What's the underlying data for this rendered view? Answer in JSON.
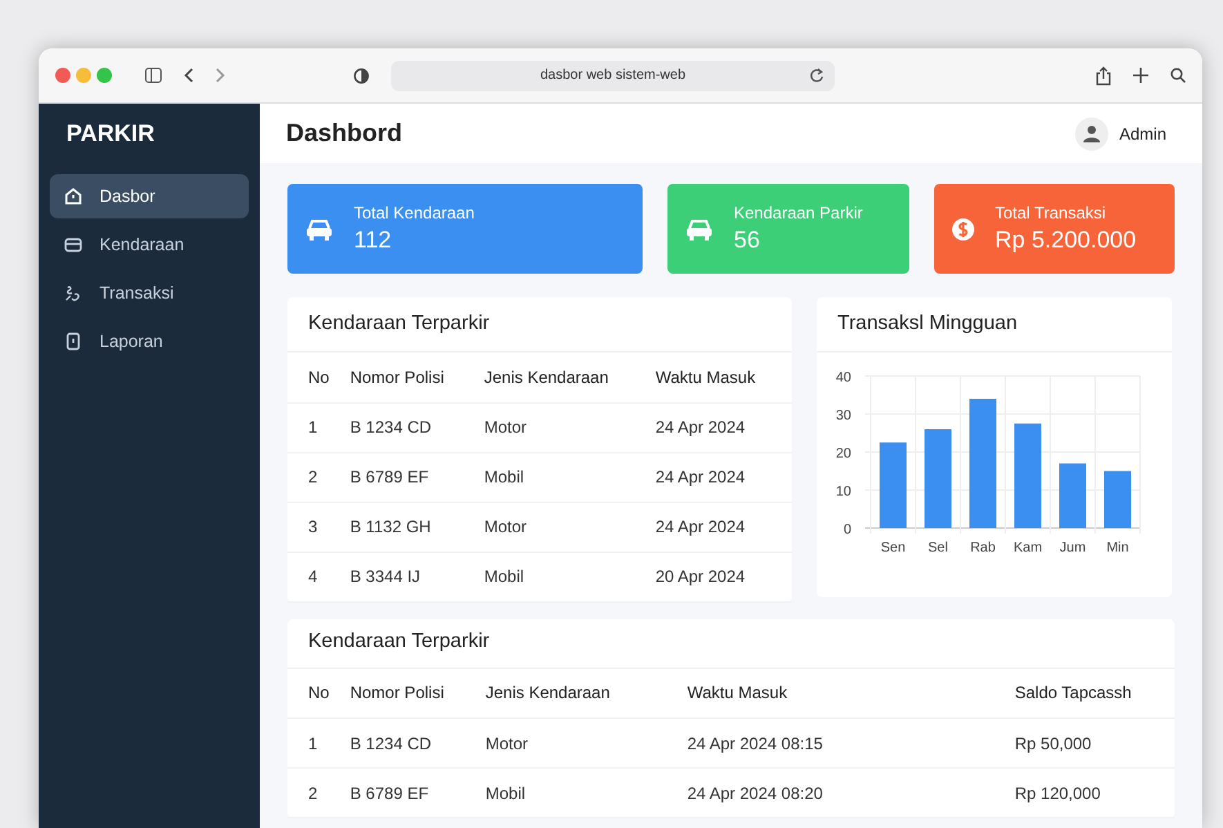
{
  "browser": {
    "address": "dasbor web sistem-web"
  },
  "sidebar": {
    "brand": "PARKIR",
    "items": [
      {
        "label": "Dasbor",
        "selected": true
      },
      {
        "label": "Kendaraan",
        "selected": false
      },
      {
        "label": "Transaksi",
        "selected": false
      },
      {
        "label": "Laporan",
        "selected": false
      }
    ]
  },
  "header": {
    "title": "Dashbord",
    "user": "Admin"
  },
  "stats": [
    {
      "label": "Total Kendaraan",
      "value": "112",
      "color": "#3b8ff0"
    },
    {
      "label": "Kendaraan Parkir",
      "value": "56",
      "color": "#3ccf78"
    },
    {
      "label": "Total Transaksi",
      "value": "Rp 5.200.000",
      "color": "#f8643a"
    }
  ],
  "parked_table": {
    "title": "Kendaraan Terparkir",
    "columns": [
      "No",
      "Nomor Polisi",
      "Jenis Kendaraan",
      "Waktu Masuk"
    ],
    "rows": [
      [
        "1",
        "B 1234 CD",
        "Motor",
        "24 Apr 2024"
      ],
      [
        "2",
        "B 6789 EF",
        "Mobil",
        "24 Apr 2024"
      ],
      [
        "3",
        "B 1132 GH",
        "Motor",
        "24 Apr 2024"
      ],
      [
        "4",
        "B 3344 IJ",
        "Mobil",
        "20 Apr 2024"
      ]
    ]
  },
  "weekly_chart": {
    "title": "Transaksl Mingguan",
    "chart_data": {
      "type": "bar",
      "categories": [
        "Sen",
        "Sel",
        "Rab",
        "Kam",
        "Jum",
        "Min"
      ],
      "series": [
        {
          "color": "#3b8ff0",
          "values": [
            22.5,
            26,
            34,
            27.5,
            17,
            15
          ]
        }
      ],
      "grid": true,
      "ylim": [
        0,
        40
      ],
      "yticks": [
        0,
        10,
        20,
        30,
        40
      ]
    }
  },
  "detail_table": {
    "title": "Kendaraan Terparkir",
    "columns": [
      "No",
      "Nomor Polisi",
      "Jenis Kendaraan",
      "Waktu Masuk",
      "Saldo Tapcassh"
    ],
    "rows": [
      [
        "1",
        "B 1234 CD",
        "Motor",
        "24 Apr 2024 08:15",
        "Rp 50,000"
      ],
      [
        "2",
        "B 6789 EF",
        "Mobil",
        "24 Apr 2024 08:20",
        "Rp 120,000"
      ]
    ]
  }
}
